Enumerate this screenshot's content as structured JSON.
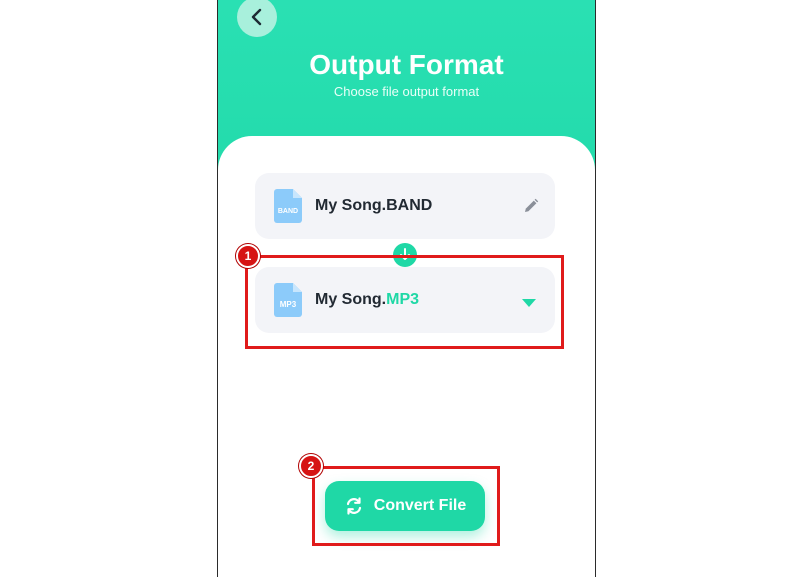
{
  "header": {
    "title": "Output Format",
    "subtitle": "Choose file output format"
  },
  "source_file": {
    "icon_label": "BAND",
    "name": "My Song.BAND"
  },
  "output_file": {
    "icon_label": "MP3",
    "base_name": "My Song.",
    "extension": "MP3"
  },
  "actions": {
    "convert_label": "Convert File"
  },
  "annotations": {
    "step1": "1",
    "step2": "2"
  },
  "colors": {
    "accent": "#1fd8a6",
    "highlight": "#e01b1b",
    "file_icon": "#7ec3f7"
  }
}
